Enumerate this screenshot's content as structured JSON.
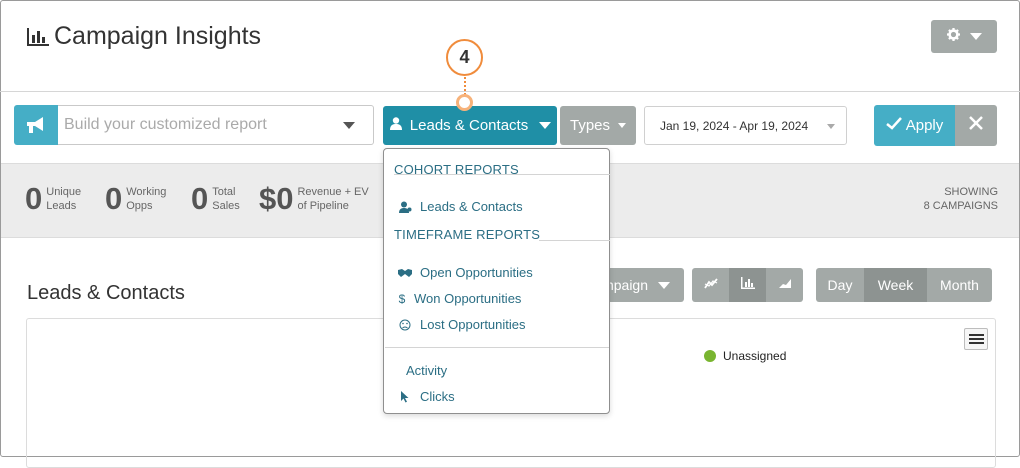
{
  "header": {
    "title": "Campaign Insights",
    "settings_icon": "gear-icon"
  },
  "toolbar": {
    "report_placeholder": "Build your customized report",
    "leads_button": "Leads & Contacts",
    "types_button": "Types",
    "date_range": "Jan 19, 2024 - Apr 19, 2024",
    "apply_button": "Apply"
  },
  "stats": [
    {
      "value": "0",
      "label_1": "Unique",
      "label_2": "Leads"
    },
    {
      "value": "0",
      "label_1": "Working",
      "label_2": "Opps"
    },
    {
      "value": "0",
      "label_1": "Total",
      "label_2": "Sales"
    },
    {
      "value": "$0",
      "label_1": "Revenue + EV",
      "label_2": "of Pipeline"
    }
  ],
  "showing": {
    "line_1": "SHOWING",
    "line_2": "8 CAMPAIGNS"
  },
  "section": {
    "title": "Leads & Contacts",
    "campaign_button": "mpaign",
    "periods": [
      "Day",
      "Week",
      "Month"
    ],
    "active_period": "Week"
  },
  "legend": {
    "label": "Unassigned",
    "color": "#79b530"
  },
  "dropdown": {
    "cohort_header": "COHORT REPORTS",
    "timeframe_header": "TIMEFRAME REPORTS",
    "items": {
      "leads_contacts": "Leads & Contacts",
      "open_opps": "Open Opportunities",
      "won_opps": "Won Opportunities",
      "lost_opps": "Lost Opportunities",
      "activity": "Activity",
      "clicks": "Clicks"
    }
  },
  "callout": {
    "number": "4",
    "color": "#f08c3c"
  },
  "colors": {
    "accent": "#45aec6",
    "accent_dark": "#1f8fa6",
    "gray_button": "#a3a9a7",
    "link": "#2b6e84"
  }
}
